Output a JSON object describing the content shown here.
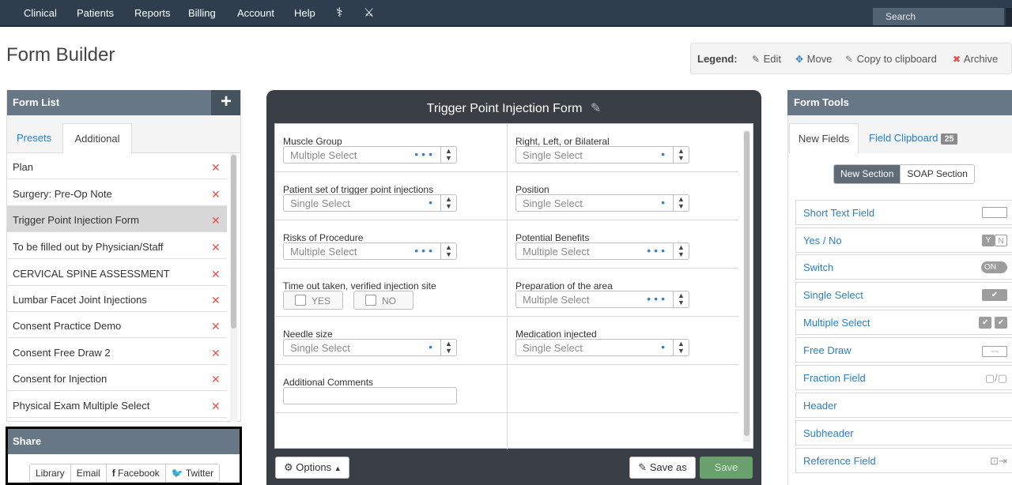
{
  "nav": {
    "items": [
      "Clinical",
      "Patients",
      "Reports",
      "Billing",
      "Account",
      "Help"
    ],
    "search_placeholder": "Search"
  },
  "page": {
    "title": "Form Builder"
  },
  "legend": {
    "title": "Legend:",
    "edit": "Edit",
    "move": "Move",
    "copy": "Copy to clipboard",
    "archive": "Archive"
  },
  "form_list": {
    "title": "Form List",
    "tabs": [
      "Presets",
      "Additional"
    ],
    "items": [
      "Plan",
      "Surgery: Pre-Op Note",
      "Trigger Point Injection Form",
      "To be filled out by Physician/Staff",
      "CERVICAL SPINE ASSESSMENT",
      "Lumbar Facet Joint Injections",
      "Consent Practice Demo",
      "Consent Free Draw 2",
      "Consent for Injection",
      "Physical Exam Multiple Select"
    ],
    "selected_index": 2
  },
  "share": {
    "title": "Share",
    "buttons": [
      "Library",
      "Email",
      "Facebook",
      "Twitter"
    ]
  },
  "form": {
    "title": "Trigger Point Injection Form",
    "fields": [
      {
        "label": "Muscle Group",
        "value": "Multiple Select"
      },
      {
        "label": "Right, Left, or Bilateral",
        "value": "Single Select"
      },
      {
        "label": "Patient set of trigger point injections",
        "value": "Single Select"
      },
      {
        "label": "Position",
        "value": "Single Select"
      },
      {
        "label": "Risks of Procedure",
        "value": "Multiple Select"
      },
      {
        "label": "Potential Benefits",
        "value": "Multiple Select"
      },
      {
        "label": "Time out taken, verified injection site",
        "yes": "YES",
        "no": "NO"
      },
      {
        "label": "Preparation of the area",
        "value": "Multiple Select"
      },
      {
        "label": "Needle size",
        "value": "Single Select"
      },
      {
        "label": "Medication injected",
        "value": "Single Select"
      },
      {
        "label": "Additional Comments",
        "value": ""
      }
    ],
    "options_label": "Options",
    "save_as_label": "Save as",
    "save_label": "Save"
  },
  "tools": {
    "title": "Form Tools",
    "tabs": {
      "new_fields": "New Fields",
      "clipboard": "Field Clipboard",
      "clipboard_count": "25"
    },
    "section_buttons": [
      "New Section",
      "SOAP Section"
    ],
    "items": [
      "Short Text Field",
      "Yes / No",
      "Switch",
      "Single Select",
      "Multiple Select",
      "Free Draw",
      "Fraction Field",
      "Header",
      "Subheader",
      "Reference Field"
    ],
    "icon_text": {
      "yes": "Y",
      "no": "N",
      "on": "ON"
    }
  },
  "colors": {
    "nav_bg": "#2e3e4e",
    "panel_head": "#687786",
    "link": "#2a7fca",
    "delete": "#e8514c",
    "save": "#6aa06d"
  }
}
